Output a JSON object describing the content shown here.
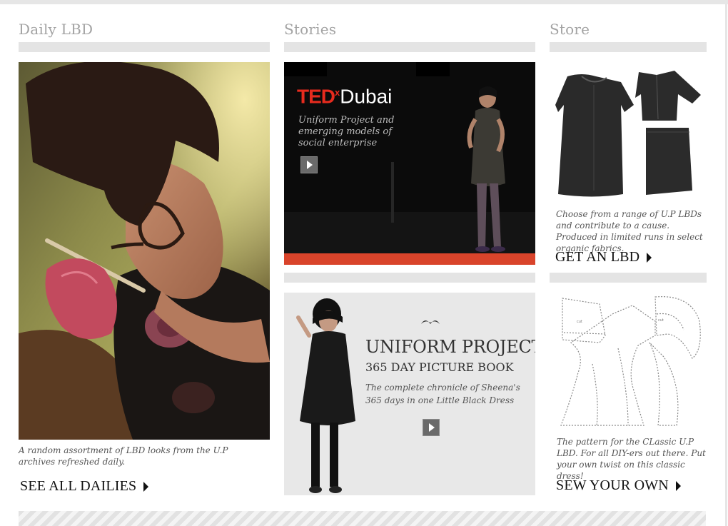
{
  "columns": {
    "daily": {
      "title": "Daily LBD",
      "caption": "A random assortment of LBD looks from the U.P archives refreshed daily.",
      "cta": "SEE ALL DAILIES"
    },
    "stories": {
      "title": "Stories",
      "ted": {
        "brand": "TED",
        "superscript": "x",
        "city": "Dubai",
        "subtitle": "Uniform Project and emerging models of social enterprise"
      },
      "book": {
        "title": "UNIFORM PROJECT",
        "subtitle": "365 DAY PICTURE BOOK",
        "description": "The complete chronicle of Sheena's 365 days in one Little Black Dress"
      }
    },
    "store": {
      "title": "Store",
      "lbd_caption": "Choose from a range of U.P LBDs and contribute to a cause. Produced in limited runs in select organic fabrics.",
      "lbd_cta": "GET AN LBD",
      "pattern_caption": "The pattern for the CLassic U.P LBD. For all DIY-ers out there. Put your own twist on this classic dress!",
      "pattern_cta": "SEW YOUR OWN"
    }
  },
  "icons": {
    "play": "play-icon",
    "arrow": "triangle-right-icon",
    "ornament": "ornament-icon"
  },
  "colors": {
    "ted_red": "#e62b1e",
    "bar_gray": "#e4e4e4",
    "heading_gray": "#a3a3a3"
  }
}
